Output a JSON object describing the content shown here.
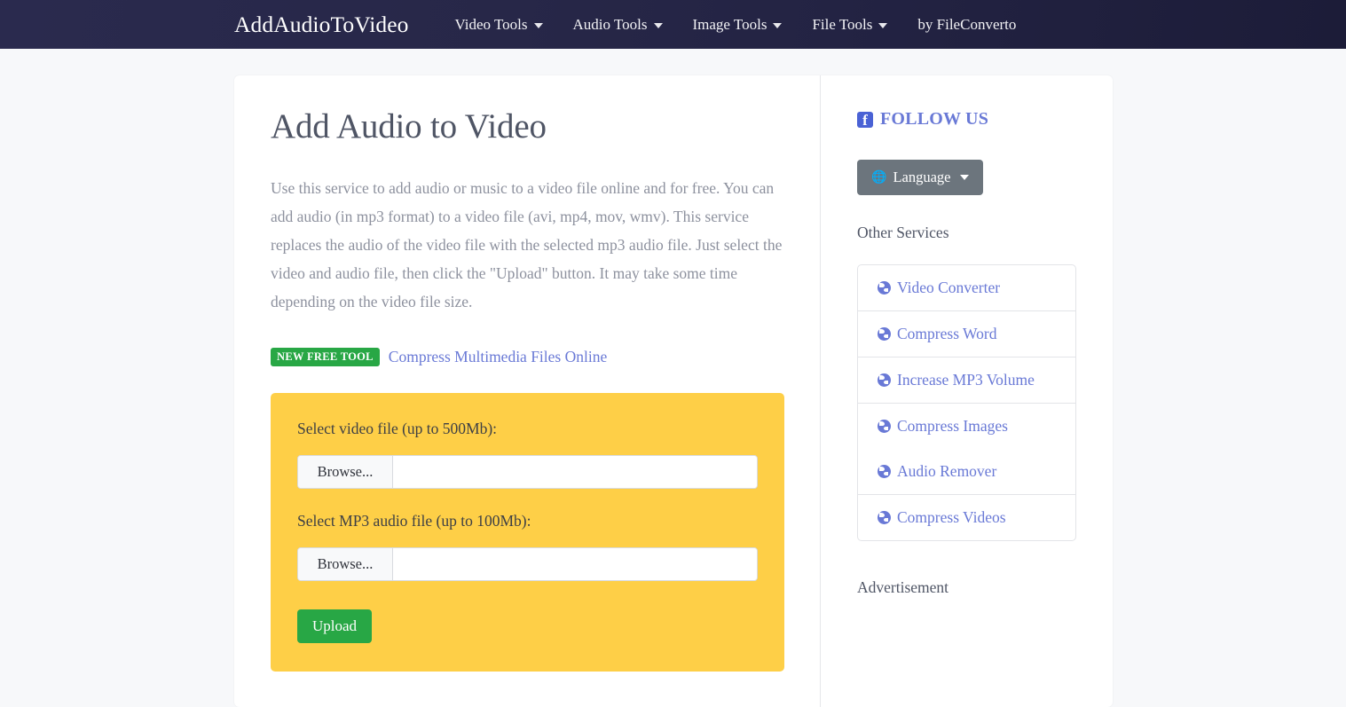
{
  "navbar": {
    "brand": "AddAudioToVideo",
    "items": [
      {
        "label": "Video Tools",
        "has_caret": true
      },
      {
        "label": "Audio Tools",
        "has_caret": true
      },
      {
        "label": "Image Tools",
        "has_caret": true
      },
      {
        "label": "File Tools",
        "has_caret": true
      },
      {
        "label": "by FileConverto",
        "has_caret": false
      }
    ]
  },
  "main": {
    "title": "Add Audio to Video",
    "intro": "Use this service to add audio or music to a video file online and for free. You can add audio (in mp3 format) to a video file (avi, mp4, mov, wmv). This service replaces the audio of the video file with the selected mp3 audio file. Just select the video and audio file, then click the \"Upload\" button. It may take some time depending on the video file size.",
    "new_tool": {
      "badge": "NEW FREE TOOL",
      "link_label": "Compress Multimedia Files Online"
    },
    "form": {
      "video_label": "Select video file (up to 500Mb):",
      "video_browse_label": "Browse...",
      "video_filename": "",
      "audio_label": "Select MP3 audio file (up to 100Mb):",
      "audio_browse_label": "Browse...",
      "audio_filename": "",
      "submit_label": "Upload",
      "box_color": "#fecf47",
      "submit_color": "#28a745"
    }
  },
  "sidebar": {
    "follow_us": "FOLLOW US",
    "facebook_glyph": "f",
    "language_button": {
      "glyph": "🌐",
      "label": "Language"
    },
    "other_services_title": "Other Services",
    "services": [
      {
        "label": "Video Converter",
        "group_end": true
      },
      {
        "label": "Compress Word",
        "group_end": true
      },
      {
        "label": "Increase MP3 Volume",
        "group_end": true
      },
      {
        "label": "Compress Images",
        "group_end": false
      },
      {
        "label": "Audio Remover",
        "group_end": true
      },
      {
        "label": "Compress Videos",
        "group_end": true
      }
    ],
    "advertisement_label": "Advertisement"
  },
  "colors": {
    "navbar_bg": "#272748",
    "accent_link": "#6979d6",
    "badge_green": "#28a745",
    "form_yellow": "#fecf47",
    "page_bg": "#f7f8fa"
  }
}
